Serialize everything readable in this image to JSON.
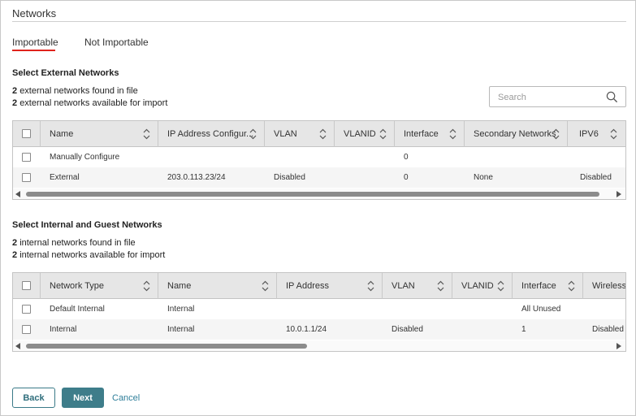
{
  "page": {
    "title": "Networks"
  },
  "tabs": [
    {
      "label": "Importable",
      "active": true
    },
    {
      "label": "Not Importable",
      "active": false
    }
  ],
  "external": {
    "section_title": "Select External Networks",
    "found_count": "2",
    "found_text": "external networks found in file",
    "available_count": "2",
    "available_text": "external networks available for import",
    "search_placeholder": "Search",
    "columns": [
      "Name",
      "IP Address Configur...",
      "VLAN",
      "VLANID",
      "Interface",
      "Secondary Networks",
      "IPV6"
    ],
    "rows": [
      [
        "Manually Configure",
        "",
        "",
        "",
        "0",
        "",
        ""
      ],
      [
        "External",
        "203.0.113.23/24",
        "Disabled",
        "",
        "0",
        "None",
        "Disabled"
      ]
    ],
    "scroll_fraction": 0.98
  },
  "internal": {
    "section_title": "Select Internal and Guest Networks",
    "found_count": "2",
    "found_text": "internal networks found in file",
    "available_count": "2",
    "available_text": "internal networks available for import",
    "columns": [
      "Network Type",
      "Name",
      "IP Address",
      "VLAN",
      "VLANID",
      "Interface",
      "Wireless"
    ],
    "rows": [
      [
        "Default Internal",
        "Internal",
        "",
        "",
        "",
        "All Unused",
        ""
      ],
      [
        "Internal",
        "Internal",
        "10.0.1.1/24",
        "Disabled",
        "",
        "1",
        "Disabled"
      ]
    ],
    "scroll_fraction": 0.48
  },
  "footer": {
    "back_label": "Back",
    "next_label": "Next",
    "cancel_label": "Cancel"
  },
  "colors": {
    "tab_underline": "#e0231c",
    "primary_button": "#3e7d8a",
    "link": "#2f7f9a"
  },
  "icons": {
    "search": "search-icon",
    "sort": "sort-arrows-icon",
    "scroll_left": "scroll-left-arrow-icon",
    "scroll_right": "scroll-right-arrow-icon"
  }
}
